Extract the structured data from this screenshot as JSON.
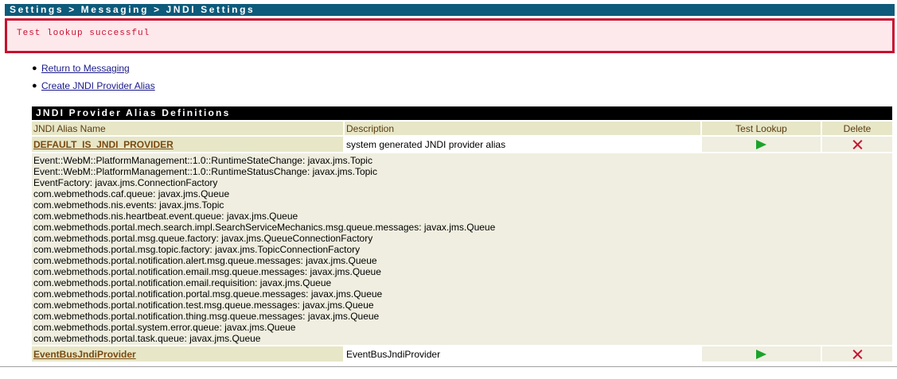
{
  "breadcrumb": "Settings > Messaging > JNDI Settings",
  "message": "Test lookup successful",
  "links": [
    {
      "label": "Return to Messaging"
    },
    {
      "label": "Create JNDI Provider Alias"
    }
  ],
  "table": {
    "title": "JNDI Provider Alias Definitions",
    "headers": {
      "alias": "JNDI Alias Name",
      "description": "Description",
      "test": "Test Lookup",
      "delete": "Delete"
    },
    "rows": [
      {
        "alias": "DEFAULT_IS_JNDI_PROVIDER",
        "description": "system generated JNDI provider alias",
        "details": [
          "Event::WebM::PlatformManagement::1.0::RuntimeStateChange: javax.jms.Topic",
          "Event::WebM::PlatformManagement::1.0::RuntimeStatusChange: javax.jms.Topic",
          "EventFactory: javax.jms.ConnectionFactory",
          "com.webmethods.caf.queue: javax.jms.Queue",
          "com.webmethods.nis.events: javax.jms.Topic",
          "com.webmethods.nis.heartbeat.event.queue: javax.jms.Queue",
          "com.webmethods.portal.mech.search.impl.SearchServiceMechanics.msg.queue.messages: javax.jms.Queue",
          "com.webmethods.portal.msg.queue.factory: javax.jms.QueueConnectionFactory",
          "com.webmethods.portal.msg.topic.factory: javax.jms.TopicConnectionFactory",
          "com.webmethods.portal.notification.alert.msg.queue.messages: javax.jms.Queue",
          "com.webmethods.portal.notification.email.msg.queue.messages: javax.jms.Queue",
          "com.webmethods.portal.notification.email.requisition: javax.jms.Queue",
          "com.webmethods.portal.notification.portal.msg.queue.messages: javax.jms.Queue",
          "com.webmethods.portal.notification.test.msg.queue.messages: javax.jms.Queue",
          "com.webmethods.portal.notification.thing.msg.queue.messages: javax.jms.Queue",
          "com.webmethods.portal.system.error.queue: javax.jms.Queue",
          "com.webmethods.portal.task.queue: javax.jms.Queue"
        ]
      },
      {
        "alias": "EventBusJndiProvider",
        "description": "EventBusJndiProvider"
      }
    ]
  },
  "icons": {
    "test": "play-icon",
    "delete": "delete-x-icon"
  },
  "colors": {
    "breadcrumb_bg": "#0d5a7a",
    "error_border": "#c8102e",
    "error_bg": "#fde8ec",
    "header_bg": "#e7e6c7",
    "alias_link": "#7a4a10",
    "play_green": "#1aa32b"
  }
}
